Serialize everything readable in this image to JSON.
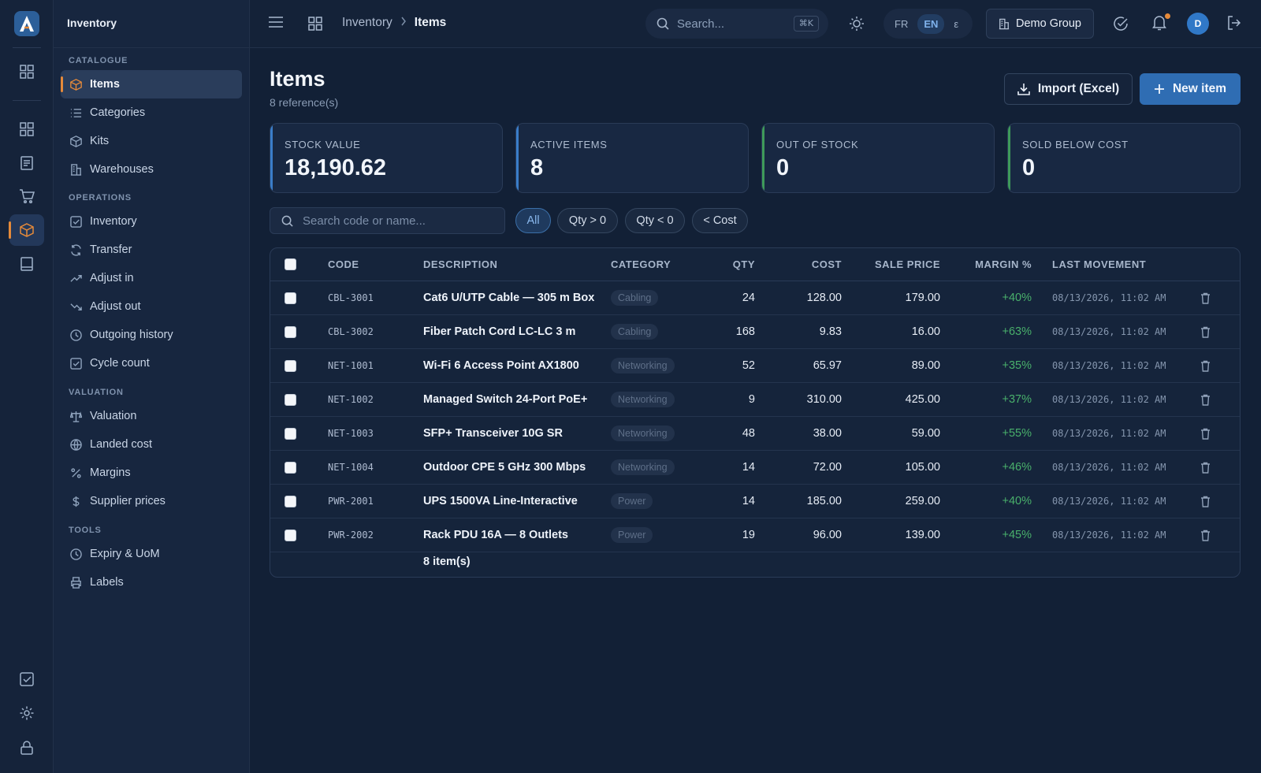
{
  "sidebar": {
    "title": "Inventory",
    "sections": [
      {
        "label": "CATALOGUE",
        "items": [
          {
            "label": "Items",
            "icon": "box-icon",
            "active": true
          },
          {
            "label": "Categories",
            "icon": "list-icon"
          },
          {
            "label": "Kits",
            "icon": "box-icon"
          },
          {
            "label": "Warehouses",
            "icon": "building-icon"
          }
        ]
      },
      {
        "label": "OPERATIONS",
        "items": [
          {
            "label": "Inventory",
            "icon": "checkbox-icon"
          },
          {
            "label": "Transfer",
            "icon": "refresh-icon"
          },
          {
            "label": "Adjust in",
            "icon": "trend-up-icon"
          },
          {
            "label": "Adjust out",
            "icon": "trend-down-icon"
          },
          {
            "label": "Outgoing history",
            "icon": "clock-icon"
          },
          {
            "label": "Cycle count",
            "icon": "checkbox-icon"
          }
        ]
      },
      {
        "label": "VALUATION",
        "items": [
          {
            "label": "Valuation",
            "icon": "scale-icon"
          },
          {
            "label": "Landed cost",
            "icon": "globe-icon"
          },
          {
            "label": "Margins",
            "icon": "percent-icon"
          },
          {
            "label": "Supplier prices",
            "icon": "dollar-icon"
          }
        ]
      },
      {
        "label": "TOOLS",
        "items": [
          {
            "label": "Expiry & UoM",
            "icon": "clock-icon"
          },
          {
            "label": "Labels",
            "icon": "printer-icon"
          }
        ]
      }
    ]
  },
  "topbar": {
    "breadcrumb": [
      "Inventory",
      "Items"
    ],
    "search_placeholder": "Search...",
    "search_shortcut": "⌘K",
    "languages": [
      "FR",
      "EN",
      "ε"
    ],
    "active_language": "EN",
    "group": "Demo Group",
    "avatar_initial": "D"
  },
  "page": {
    "title": "Items",
    "subtitle": "8 reference(s)",
    "import_label": "Import (Excel)",
    "new_label": "New item"
  },
  "stats": [
    {
      "label": "STOCK VALUE",
      "value": "18,190.62",
      "accent": "#3a7dc9"
    },
    {
      "label": "ACTIVE ITEMS",
      "value": "8",
      "accent": "#3a7dc9"
    },
    {
      "label": "OUT OF STOCK",
      "value": "0",
      "accent": "#3e9a5a"
    },
    {
      "label": "SOLD BELOW COST",
      "value": "0",
      "accent": "#3e9a5a"
    }
  ],
  "filters": {
    "search_placeholder": "Search code or name...",
    "chips": [
      "All",
      "Qty > 0",
      "Qty < 0",
      "< Cost"
    ],
    "active_chip": "All"
  },
  "table": {
    "columns": [
      "CODE",
      "DESCRIPTION",
      "CATEGORY",
      "QTY",
      "COST",
      "SALE PRICE",
      "MARGIN %",
      "LAST MOVEMENT"
    ],
    "rows": [
      {
        "code": "CBL-3001",
        "description": "Cat6 U/UTP Cable — 305 m Box",
        "category": "Cabling",
        "qty": "24",
        "cost": "128.00",
        "price": "179.00",
        "margin": "+40%",
        "last": "08/13/2026, 11:02 AM"
      },
      {
        "code": "CBL-3002",
        "description": "Fiber Patch Cord LC-LC 3 m",
        "category": "Cabling",
        "qty": "168",
        "cost": "9.83",
        "price": "16.00",
        "margin": "+63%",
        "last": "08/13/2026, 11:02 AM"
      },
      {
        "code": "NET-1001",
        "description": "Wi-Fi 6 Access Point AX1800",
        "category": "Networking",
        "qty": "52",
        "cost": "65.97",
        "price": "89.00",
        "margin": "+35%",
        "last": "08/13/2026, 11:02 AM"
      },
      {
        "code": "NET-1002",
        "description": "Managed Switch 24-Port PoE+",
        "category": "Networking",
        "qty": "9",
        "cost": "310.00",
        "price": "425.00",
        "margin": "+37%",
        "last": "08/13/2026, 11:02 AM"
      },
      {
        "code": "NET-1003",
        "description": "SFP+ Transceiver 10G SR",
        "category": "Networking",
        "qty": "48",
        "cost": "38.00",
        "price": "59.00",
        "margin": "+55%",
        "last": "08/13/2026, 11:02 AM"
      },
      {
        "code": "NET-1004",
        "description": "Outdoor CPE 5 GHz 300 Mbps",
        "category": "Networking",
        "qty": "14",
        "cost": "72.00",
        "price": "105.00",
        "margin": "+46%",
        "last": "08/13/2026, 11:02 AM"
      },
      {
        "code": "PWR-2001",
        "description": "UPS 1500VA Line-Interactive",
        "category": "Power",
        "qty": "14",
        "cost": "185.00",
        "price": "259.00",
        "margin": "+40%",
        "last": "08/13/2026, 11:02 AM"
      },
      {
        "code": "PWR-2002",
        "description": "Rack PDU 16A — 8 Outlets",
        "category": "Power",
        "qty": "19",
        "cost": "96.00",
        "price": "139.00",
        "margin": "+45%",
        "last": "08/13/2026, 11:02 AM"
      }
    ],
    "footer": "8 item(s)"
  }
}
